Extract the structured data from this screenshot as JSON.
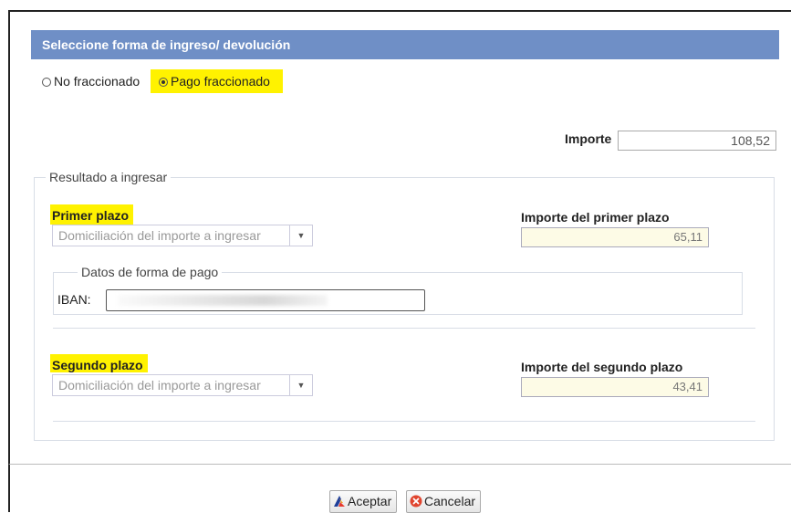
{
  "header": {
    "title": "Seleccione forma de ingreso/ devolución"
  },
  "payment_mode": {
    "options": [
      {
        "label": "No fraccionado",
        "selected": false
      },
      {
        "label": "Pago fraccionado",
        "selected": true
      }
    ]
  },
  "importe": {
    "label": "Importe",
    "value": "108,52"
  },
  "resultado": {
    "legend": "Resultado a ingresar",
    "primer_plazo": {
      "label": "Primer plazo",
      "select_value": "Domiciliación del importe a ingresar",
      "amount_label": "Importe del primer plazo",
      "amount_value": "65,11"
    },
    "datos_pago": {
      "legend": "Datos de forma de pago",
      "iban_label": "IBAN:",
      "iban_value": ""
    },
    "segundo_plazo": {
      "label": "Segundo plazo",
      "select_value": "Domiciliación del importe a ingresar",
      "amount_label": "Importe del segundo plazo",
      "amount_value": "43,41"
    }
  },
  "buttons": {
    "accept": "Aceptar",
    "cancel": "Cancelar"
  },
  "colors": {
    "header_bg": "#6f8fc6",
    "highlight": "#fff200",
    "amount_bg": "#fdfbe6"
  },
  "icons": {
    "accept": "aeat-logo-icon",
    "cancel": "cancel-x-icon"
  }
}
